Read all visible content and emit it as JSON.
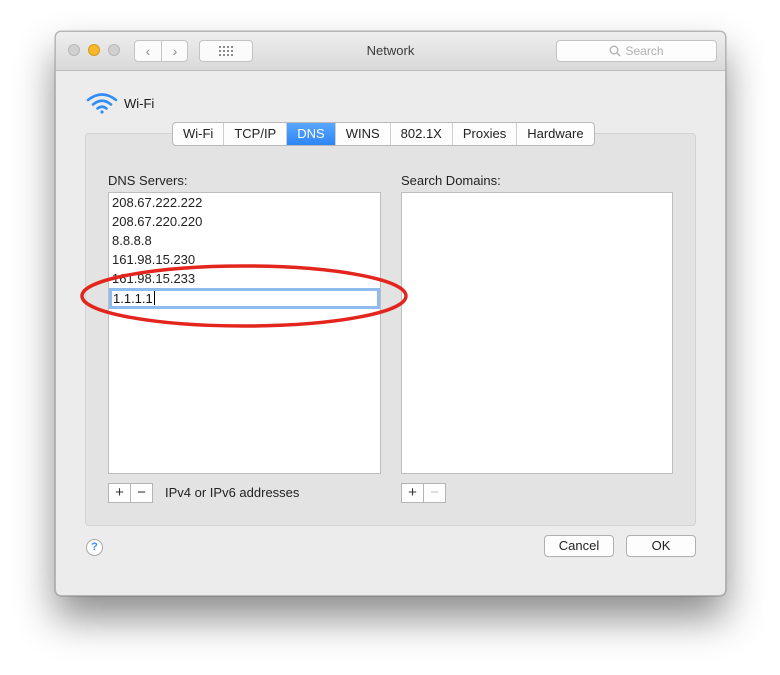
{
  "window": {
    "title": "Network",
    "search_placeholder": "Search"
  },
  "nav": {
    "back_glyph": "‹",
    "forward_glyph": "›"
  },
  "interface": {
    "name": "Wi-Fi",
    "icon": "wifi-icon"
  },
  "tabs": [
    {
      "label": "Wi-Fi",
      "active": false
    },
    {
      "label": "TCP/IP",
      "active": false
    },
    {
      "label": "DNS",
      "active": true
    },
    {
      "label": "WINS",
      "active": false
    },
    {
      "label": "802.1X",
      "active": false
    },
    {
      "label": "Proxies",
      "active": false
    },
    {
      "label": "Hardware",
      "active": false
    }
  ],
  "dns": {
    "label": "DNS Servers:",
    "servers": [
      "208.67.222.222",
      "208.67.220.220",
      "8.8.8.8",
      "161.98.15.230",
      "161.98.15.233"
    ],
    "editing_value": "1.1.1.1",
    "hint": "IPv4 or IPv6 addresses",
    "add_glyph": "+",
    "remove_glyph": "−"
  },
  "search_domains": {
    "label": "Search Domains:",
    "add_glyph": "+",
    "remove_glyph": "−"
  },
  "footer": {
    "help_glyph": "?",
    "cancel_label": "Cancel",
    "ok_label": "OK"
  },
  "colors": {
    "accent": "#2c86f5",
    "annotation": "#e3251d",
    "traffic_min": "#f5b72c"
  }
}
